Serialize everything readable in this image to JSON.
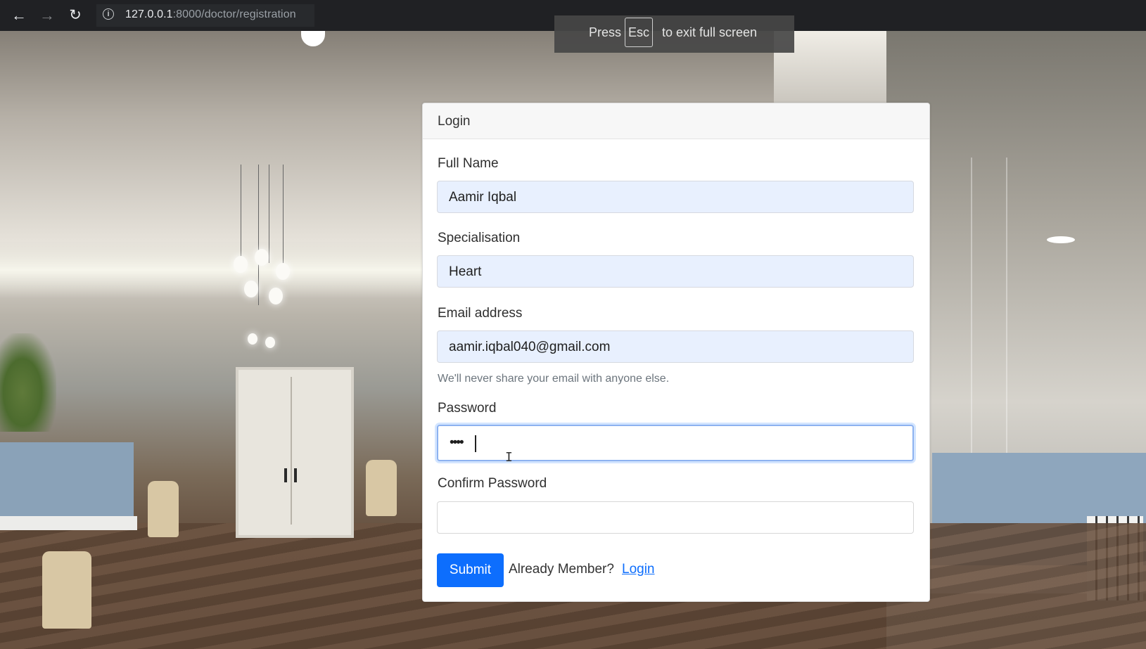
{
  "browser": {
    "url_host": "127.0.0.1",
    "url_path": ":8000/doctor/registration",
    "back_icon": "arrow-left-icon",
    "forward_icon": "arrow-right-icon",
    "reload_icon": "reload-icon",
    "info_icon": "info-icon"
  },
  "fullscreen_tip": {
    "prefix": "Press",
    "key": "Esc",
    "suffix": "to exit full screen"
  },
  "form": {
    "title": "Login",
    "full_name": {
      "label": "Full Name",
      "value": "Aamir Iqbal"
    },
    "specialisation": {
      "label": "Specialisation",
      "value": "Heart"
    },
    "email": {
      "label": "Email address",
      "value": "aamir.iqbal040@gmail.com",
      "help": "We'll never share your email with anyone else."
    },
    "password": {
      "label": "Password",
      "value": "••••"
    },
    "confirm_password": {
      "label": "Confirm Password",
      "value": ""
    },
    "submit_label": "Submit",
    "already_member": "Already Member?",
    "login_link": "Login"
  },
  "colors": {
    "primary": "#0d6efd",
    "autofill_bg": "#e8f0fe",
    "toolbar_bg": "#202124"
  }
}
